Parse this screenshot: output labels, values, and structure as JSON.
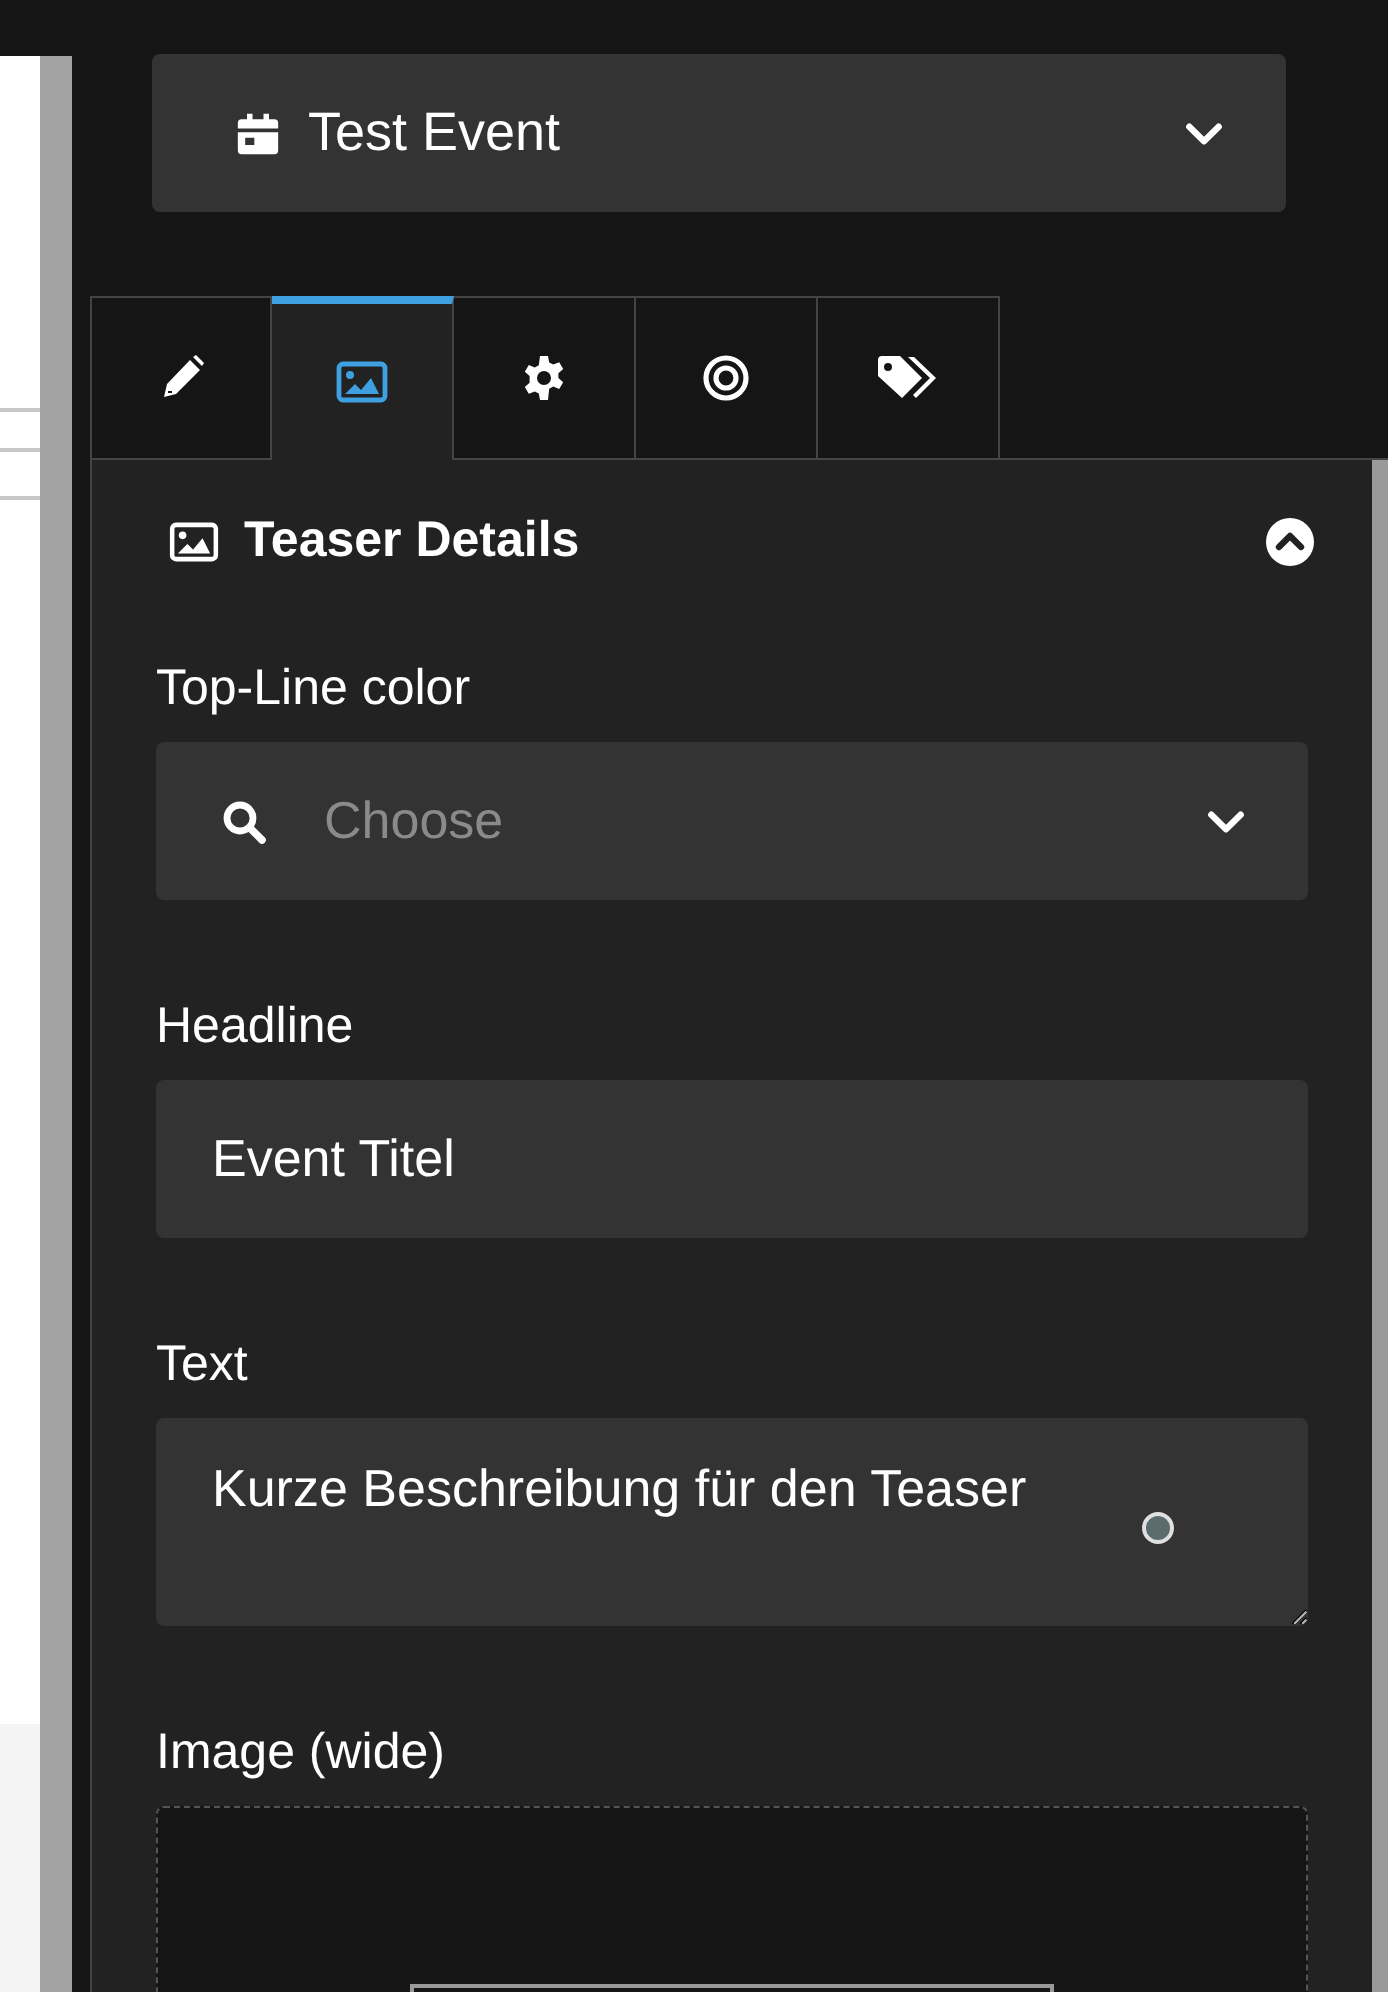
{
  "event_select": {
    "value": "Test Event"
  },
  "tabs": [
    {
      "kind": "pencil",
      "selected": false
    },
    {
      "kind": "image",
      "selected": true
    },
    {
      "kind": "gear",
      "selected": false
    },
    {
      "kind": "target",
      "selected": false
    },
    {
      "kind": "tags",
      "selected": false
    }
  ],
  "section": {
    "title": "Teaser Details",
    "expanded": true
  },
  "fields": [
    {
      "kind": "select",
      "label": "Top-Line color",
      "placeholder": "Choose"
    },
    {
      "kind": "text",
      "label": "Headline",
      "value": "Event Titel"
    },
    {
      "kind": "textarea",
      "label": "Text",
      "value": "Kurze Beschreibung für den Teaser"
    },
    {
      "kind": "image",
      "label": "Image (wide)"
    }
  ]
}
